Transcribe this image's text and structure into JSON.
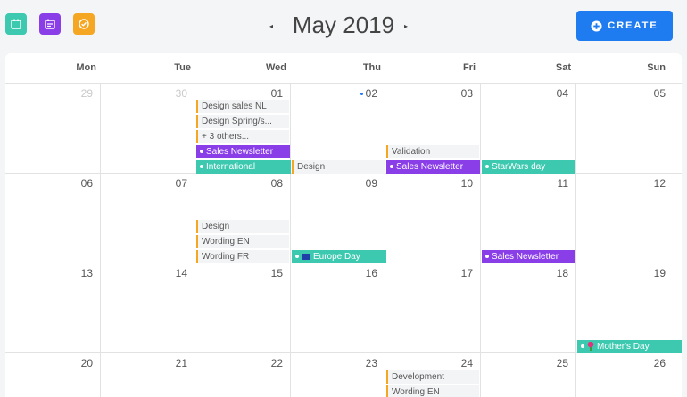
{
  "toolbar": {
    "view_buttons": [
      {
        "icon": "calendar-icon",
        "color": "#3cc9b0"
      },
      {
        "icon": "calendar-edit-icon",
        "color": "#8a3ee8"
      },
      {
        "icon": "check-circle-icon",
        "color": "#f5a623"
      }
    ],
    "prev_glyph": "◂",
    "next_glyph": "▸",
    "month_title": "May 2019",
    "create_label": "CREATE",
    "create_color": "#1e7bf0"
  },
  "weekdays": [
    "Mon",
    "Tue",
    "Wed",
    "Thu",
    "Fri",
    "Sat",
    "Sun"
  ],
  "weeks": [
    [
      "29",
      "30",
      "01",
      "02",
      "03",
      "04",
      "05"
    ],
    [
      "06",
      "07",
      "08",
      "09",
      "10",
      "11",
      "12"
    ],
    [
      "13",
      "14",
      "15",
      "16",
      "17",
      "18",
      "19"
    ],
    [
      "20",
      "21",
      "22",
      "23",
      "24",
      "25",
      "26"
    ]
  ],
  "events": {
    "design_sales_nl": "Design sales NL",
    "design_spring": "Design Spring/s...",
    "others": "+ 3 others...",
    "sales_newsletter_1": "Sales Newsletter",
    "international": "International",
    "design_thu": "Design",
    "validation": "Validation",
    "sales_newsletter_2": "Sales Newsletter",
    "starwars": "StarWars day",
    "design_wed8": "Design",
    "wording_en_1": "Wording EN",
    "wording_fr": "Wording FR",
    "europe_day": "Europe Day",
    "sales_newsletter_3": "Sales Newsletter",
    "mothers_day": "Mother's Day",
    "development": "Development",
    "wording_en_2": "Wording EN"
  },
  "colors": {
    "task_border": "#f5a623",
    "purple_event": "#8a3ee8",
    "teal_event": "#3cc9b0"
  }
}
